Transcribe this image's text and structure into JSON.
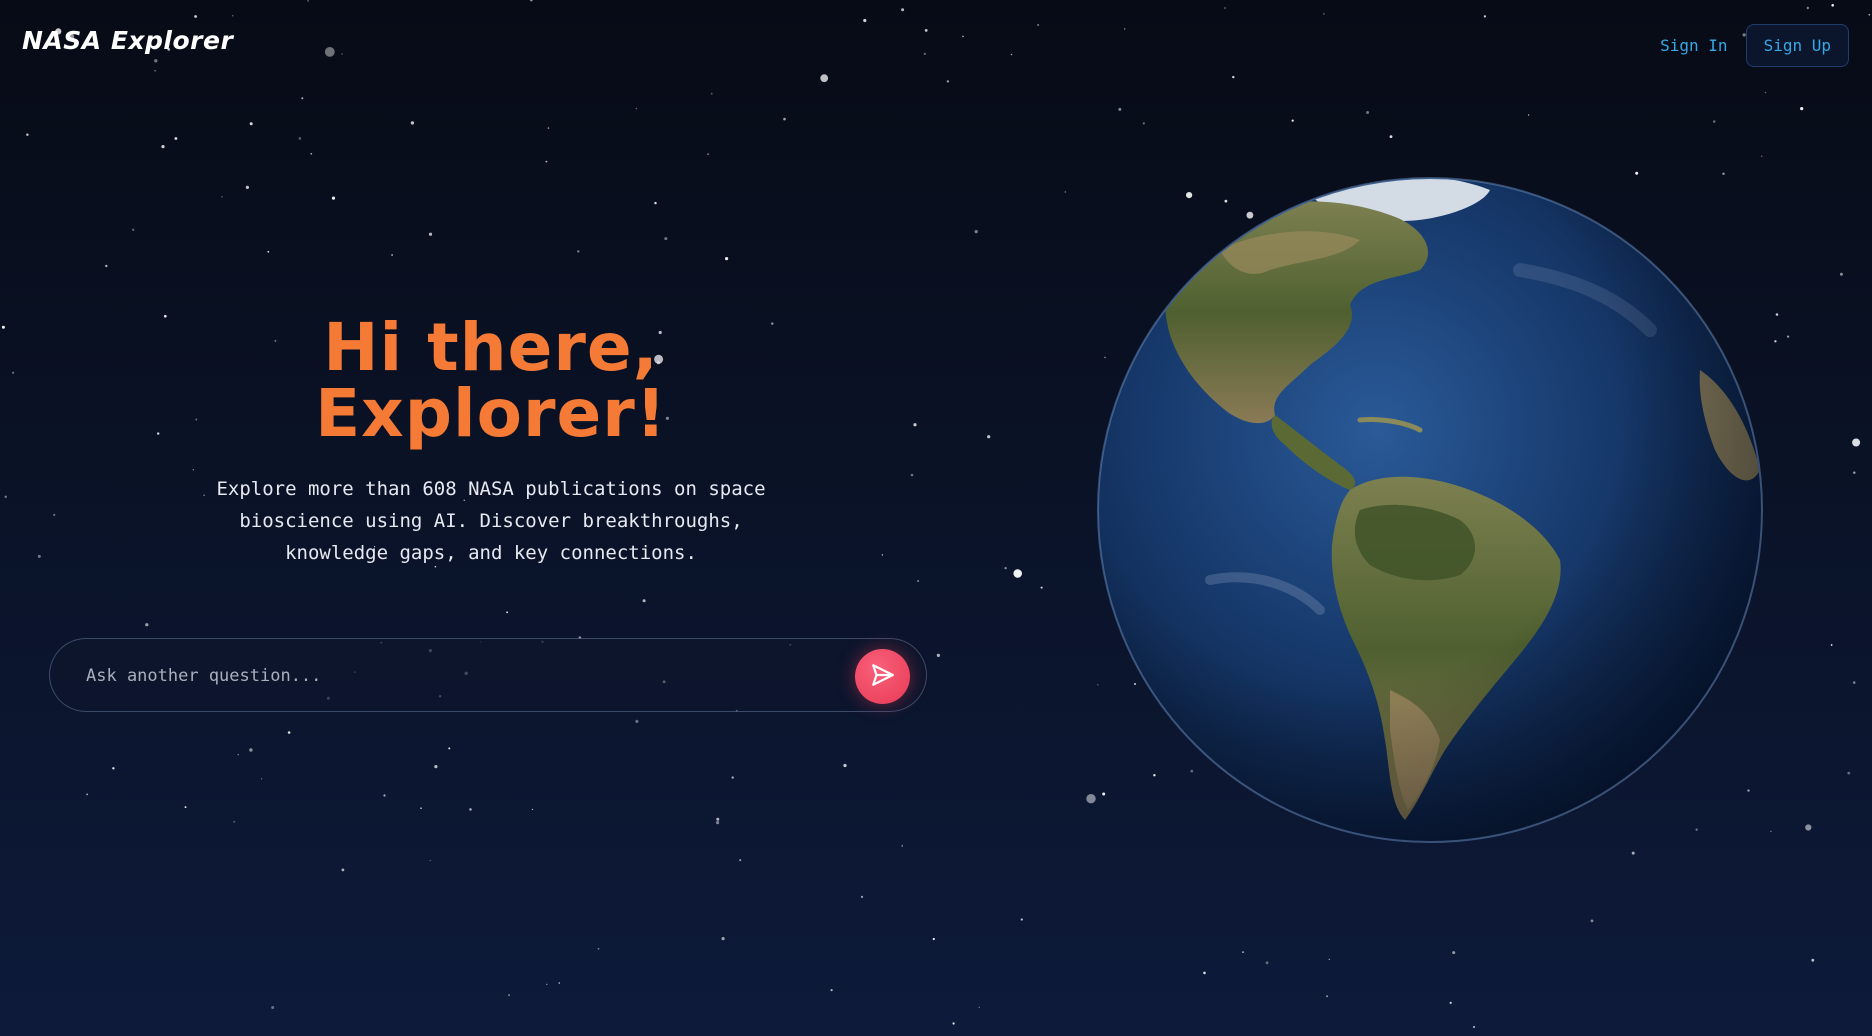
{
  "header": {
    "logo": "NASA Explorer",
    "sign_in_label": "Sign In",
    "sign_up_label": "Sign Up"
  },
  "hero": {
    "headline_line1": "Hi there,",
    "headline_line2": "Explorer!",
    "description": "Explore more than 608 NASA publications on space bioscience using AI. Discover breakthroughs, knowledge gaps, and key connections."
  },
  "search": {
    "placeholder": "Ask another question...",
    "value": ""
  },
  "icons": {
    "send": "paper-plane-icon",
    "globe": "earth-globe"
  },
  "colors": {
    "headline": "#f47a35",
    "accent_link": "#35a8e6",
    "send_button": "#e83a55",
    "background": "#0a1226"
  }
}
